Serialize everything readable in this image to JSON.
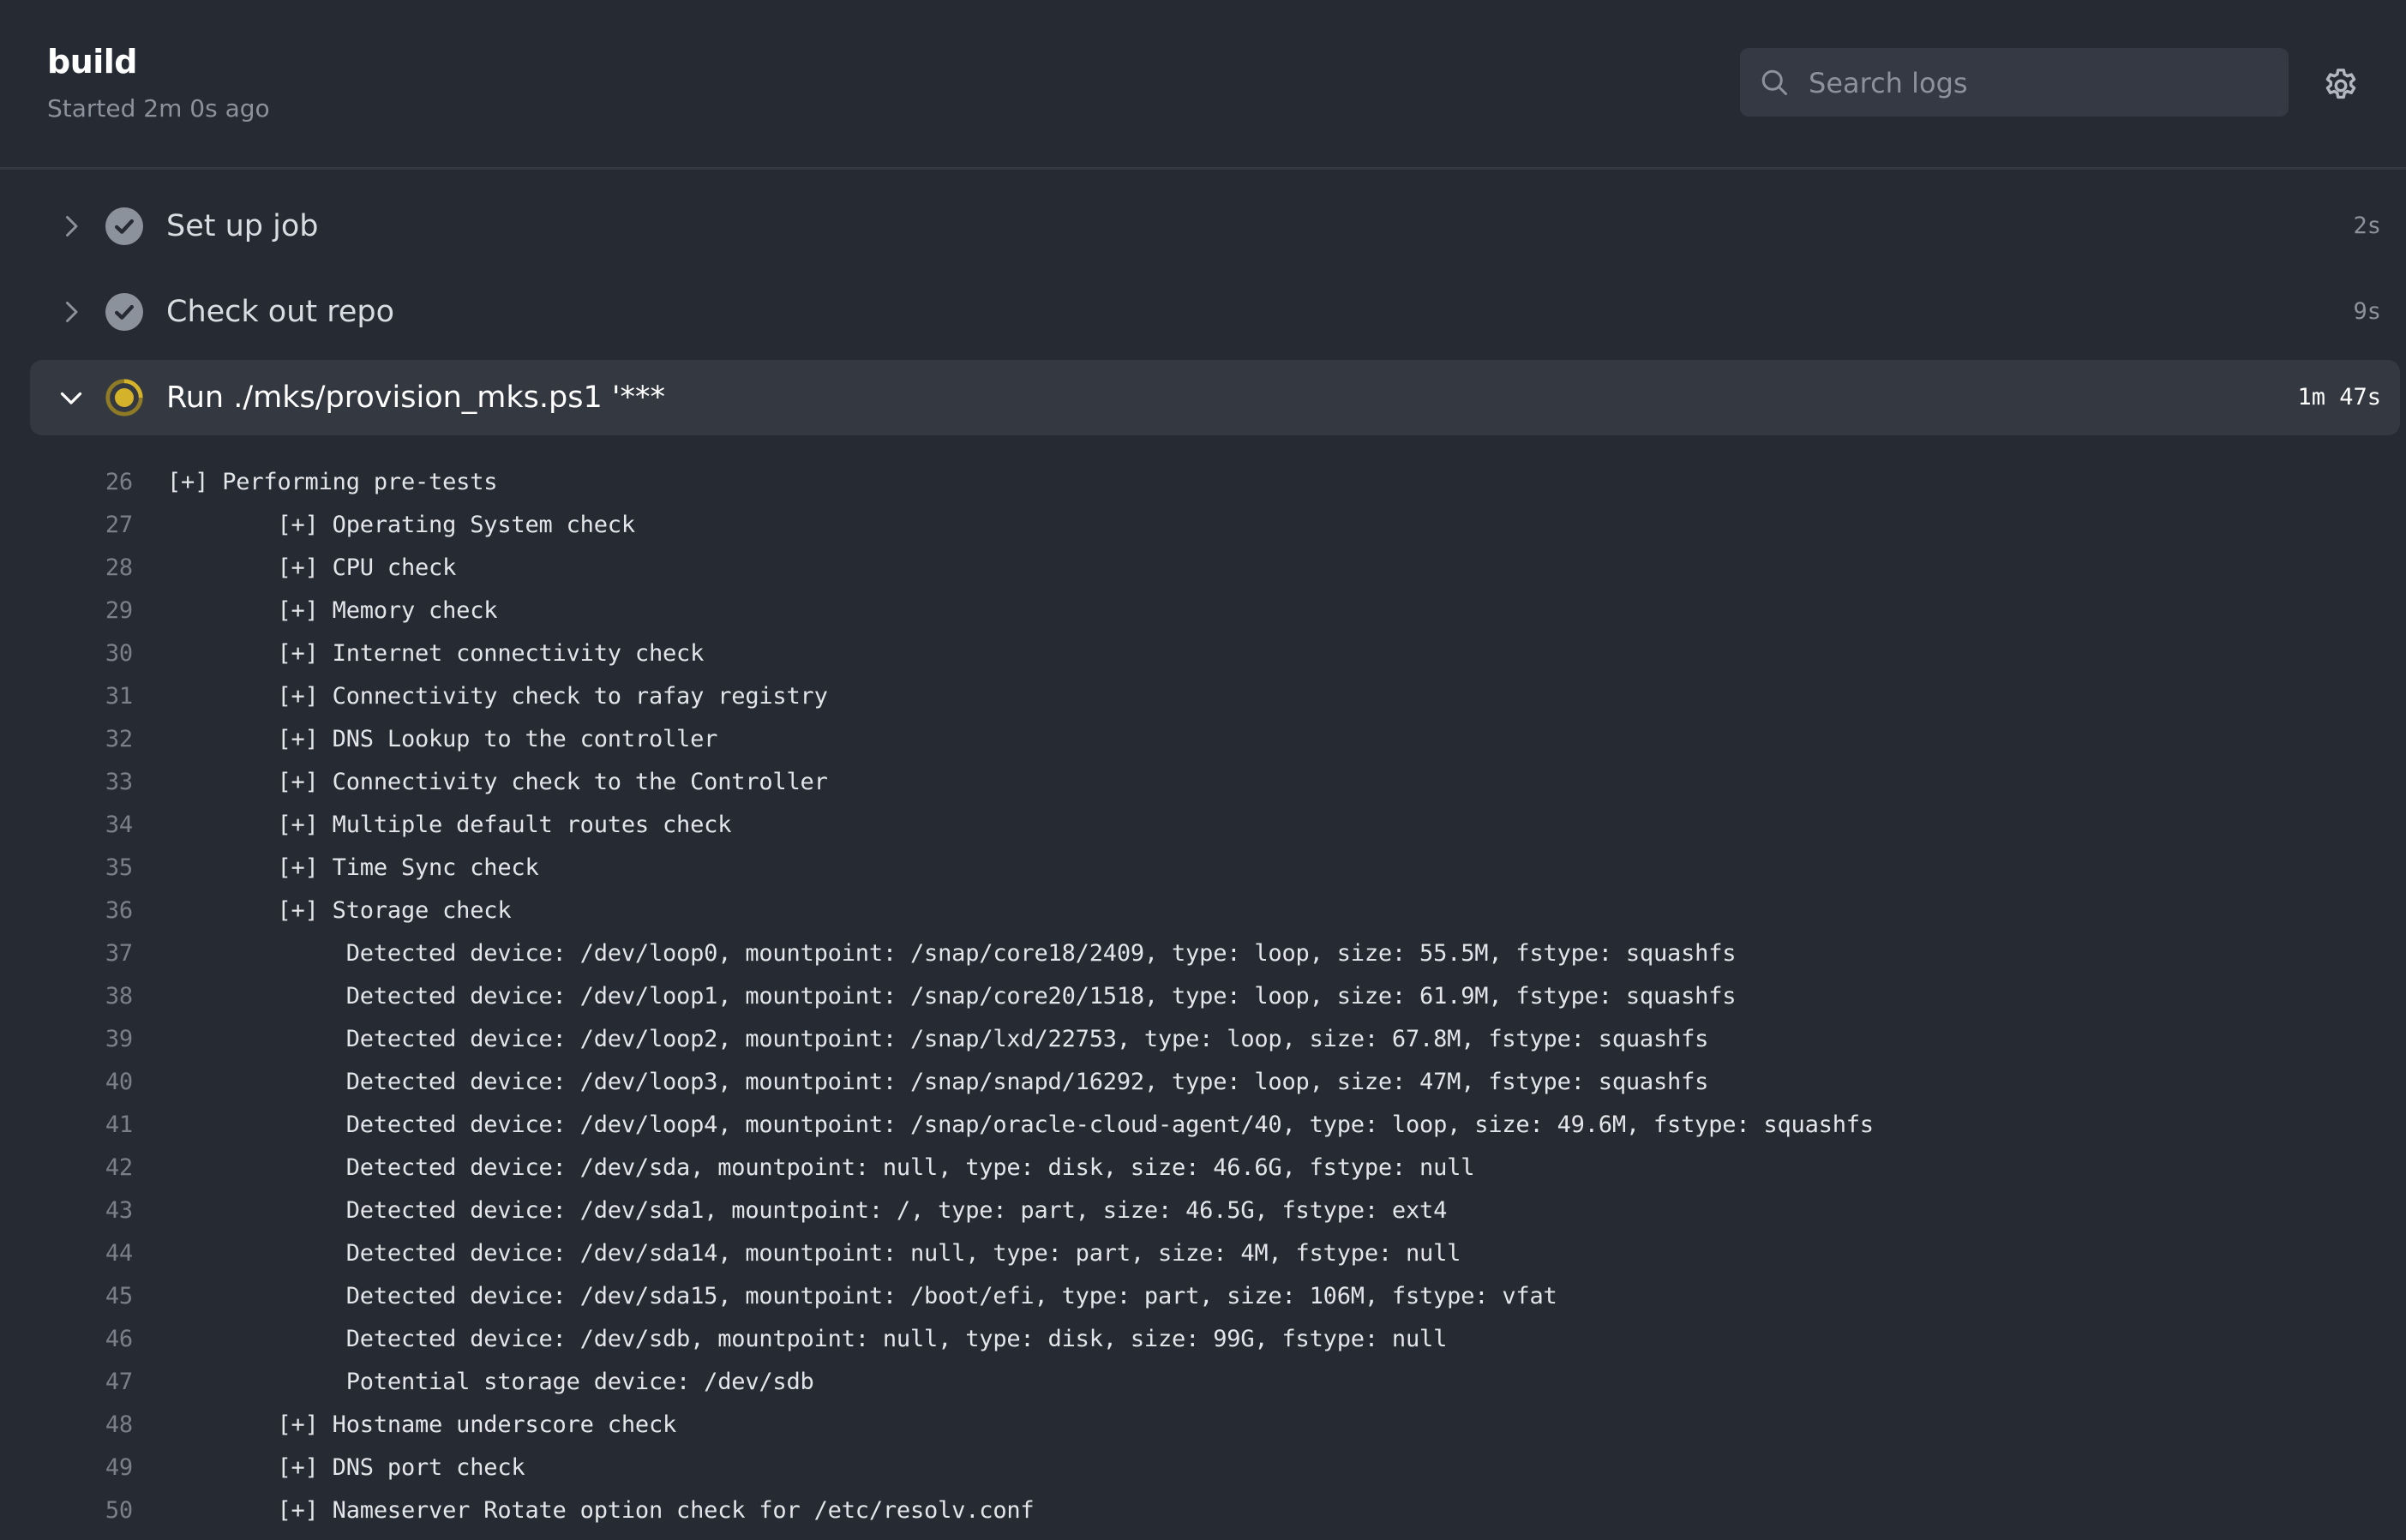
{
  "header": {
    "title": "build",
    "subtitle": "Started 2m 0s ago",
    "search": {
      "placeholder": "Search logs",
      "value": "",
      "icon": "search-icon"
    },
    "settings_icon": "gear-icon"
  },
  "colors": {
    "background": "#262a33",
    "active_row": "#343841",
    "success_icon": "#8c929c",
    "running_icon": "#d4b32b",
    "muted_text": "#8c929c"
  },
  "steps": [
    {
      "name": "Set up job",
      "duration": "2s",
      "status": "success",
      "expanded": false
    },
    {
      "name": "Check out repo",
      "duration": "9s",
      "status": "success",
      "expanded": false
    },
    {
      "name": "Run ./mks/provision_mks.ps1 '***",
      "duration": "1m 47s",
      "status": "in-progress",
      "expanded": true
    }
  ],
  "log": [
    {
      "n": "26",
      "text": "[+] Performing pre-tests"
    },
    {
      "n": "27",
      "text": "        [+] Operating System check"
    },
    {
      "n": "28",
      "text": "        [+] CPU check"
    },
    {
      "n": "29",
      "text": "        [+] Memory check"
    },
    {
      "n": "30",
      "text": "        [+] Internet connectivity check"
    },
    {
      "n": "31",
      "text": "        [+] Connectivity check to rafay registry"
    },
    {
      "n": "32",
      "text": "        [+] DNS Lookup to the controller"
    },
    {
      "n": "33",
      "text": "        [+] Connectivity check to the Controller"
    },
    {
      "n": "34",
      "text": "        [+] Multiple default routes check"
    },
    {
      "n": "35",
      "text": "        [+] Time Sync check"
    },
    {
      "n": "36",
      "text": "        [+] Storage check"
    },
    {
      "n": "37",
      "text": "             Detected device: /dev/loop0, mountpoint: /snap/core18/2409, type: loop, size: 55.5M, fstype: squashfs"
    },
    {
      "n": "38",
      "text": "             Detected device: /dev/loop1, mountpoint: /snap/core20/1518, type: loop, size: 61.9M, fstype: squashfs"
    },
    {
      "n": "39",
      "text": "             Detected device: /dev/loop2, mountpoint: /snap/lxd/22753, type: loop, size: 67.8M, fstype: squashfs"
    },
    {
      "n": "40",
      "text": "             Detected device: /dev/loop3, mountpoint: /snap/snapd/16292, type: loop, size: 47M, fstype: squashfs"
    },
    {
      "n": "41",
      "text": "             Detected device: /dev/loop4, mountpoint: /snap/oracle-cloud-agent/40, type: loop, size: 49.6M, fstype: squashfs"
    },
    {
      "n": "42",
      "text": "             Detected device: /dev/sda, mountpoint: null, type: disk, size: 46.6G, fstype: null"
    },
    {
      "n": "43",
      "text": "             Detected device: /dev/sda1, mountpoint: /, type: part, size: 46.5G, fstype: ext4"
    },
    {
      "n": "44",
      "text": "             Detected device: /dev/sda14, mountpoint: null, type: part, size: 4M, fstype: null"
    },
    {
      "n": "45",
      "text": "             Detected device: /dev/sda15, mountpoint: /boot/efi, type: part, size: 106M, fstype: vfat"
    },
    {
      "n": "46",
      "text": "             Detected device: /dev/sdb, mountpoint: null, type: disk, size: 99G, fstype: null"
    },
    {
      "n": "47",
      "text": "             Potential storage device: /dev/sdb"
    },
    {
      "n": "48",
      "text": "        [+] Hostname underscore check"
    },
    {
      "n": "49",
      "text": "        [+] DNS port check"
    },
    {
      "n": "50",
      "text": "        [+] Nameserver Rotate option check for /etc/resolv.conf"
    }
  ]
}
